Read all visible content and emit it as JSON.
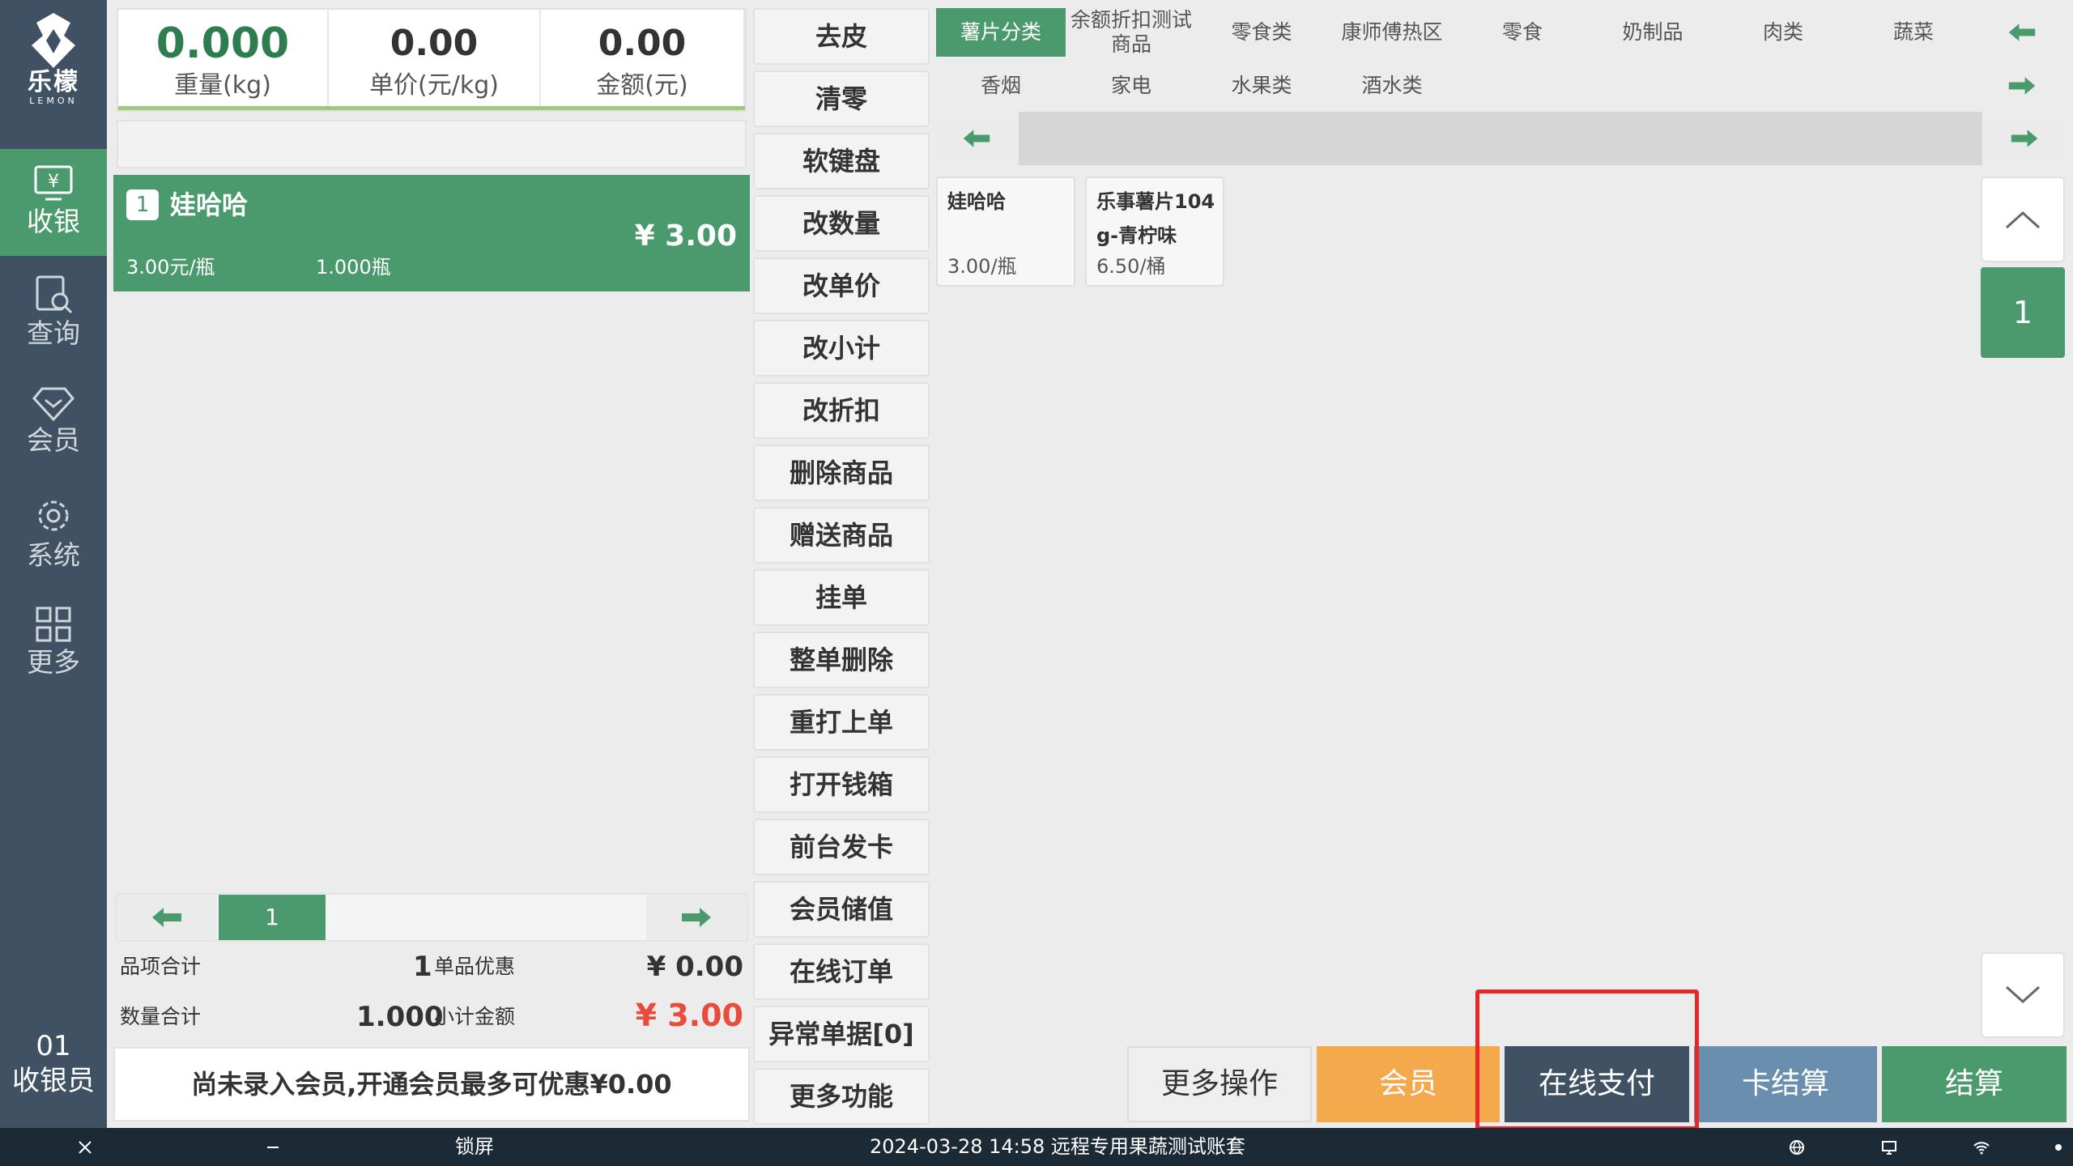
{
  "brand": {
    "name_cn": "乐檬",
    "name_en": "LEMON"
  },
  "nav": [
    {
      "label": "收银",
      "icon": "cashier-icon",
      "active": true
    },
    {
      "label": "查询",
      "icon": "query-icon",
      "active": false
    },
    {
      "label": "会员",
      "icon": "diamond-icon",
      "active": false
    },
    {
      "label": "系统",
      "icon": "gear-icon",
      "active": false
    },
    {
      "label": "更多",
      "icon": "grid-icon",
      "active": false
    }
  ],
  "cashier": {
    "number": "01",
    "label": "收银员"
  },
  "scale": {
    "weight": {
      "value": "0.000",
      "label": "重量(kg)"
    },
    "unit_price": {
      "value": "0.00",
      "label": "单价(元/kg)"
    },
    "amount": {
      "value": "0.00",
      "label": "金额(元)"
    }
  },
  "cart": {
    "items": [
      {
        "index": "1",
        "name": "娃哈哈",
        "amount": "¥ 3.00",
        "unit_price": "3.00元/瓶",
        "qty": "1.000瓶"
      }
    ],
    "page": "1"
  },
  "totals": {
    "item_count_label": "品项合计",
    "item_count": "1",
    "discount_label": "单品优惠",
    "discount": "¥ 0.00",
    "qty_label": "数量合计",
    "qty": "1.000",
    "subtotal_label": "小计金额",
    "subtotal": "¥ 3.00"
  },
  "member_promo": "尚未录入会员,开通会员最多可优惠¥0.00",
  "functions": [
    "去皮",
    "清零",
    "软键盘",
    "改数量",
    "改单价",
    "改小计",
    "改折扣",
    "删除商品",
    "赠送商品",
    "挂单",
    "整单删除",
    "重打上单",
    "打开钱箱",
    "前台发卡",
    "会员储值",
    "在线订单",
    "异常单据[0]",
    "更多功能"
  ],
  "categories_row1": [
    "薯片分类",
    "余额折扣测试商品",
    "零食类",
    "康师傅热区",
    "零食",
    "奶制品",
    "肉类",
    "蔬菜"
  ],
  "categories_row2": [
    "香烟",
    "家电",
    "水果类",
    "酒水类"
  ],
  "products": [
    {
      "name": "娃哈哈",
      "price": "3.00/瓶"
    },
    {
      "name": "乐事薯片104g-青柠味",
      "price": "6.50/桶"
    }
  ],
  "product_page": "1",
  "actions": {
    "more": "更多操作",
    "member": "会员",
    "online_pay": "在线支付",
    "card_settle": "卡结算",
    "settle": "结算"
  },
  "taskbar": {
    "lock": "锁屏",
    "status": "2024-03-28 14:58 远程专用果蔬测试账套"
  },
  "colors": {
    "sidebar": "#3f5162",
    "accent_green": "#4a9a6e",
    "orange": "#f3a94c",
    "blue": "#6a8fae",
    "red": "#e74c3c"
  }
}
